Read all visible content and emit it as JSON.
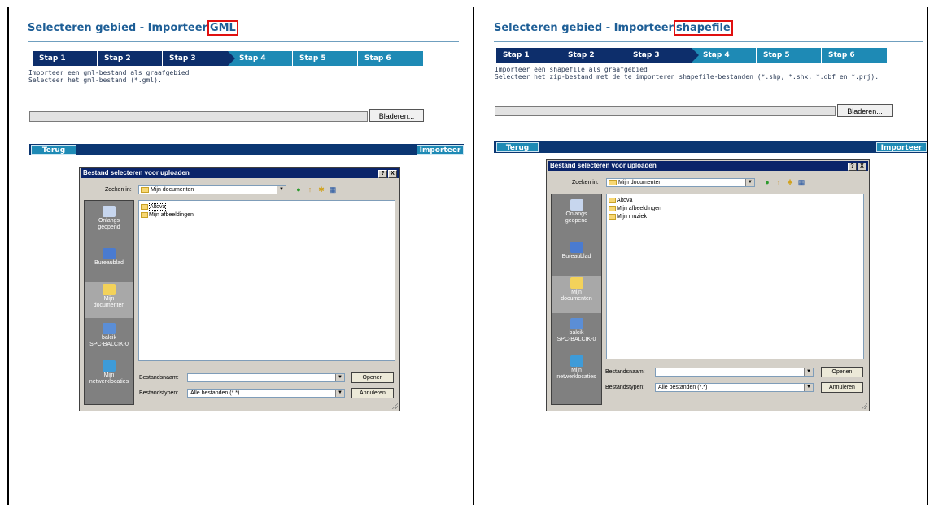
{
  "panels": [
    {
      "title_prefix": "Selecteren gebied - Importeer",
      "title_highlight": "GML",
      "steps": [
        {
          "label": "Stap 1",
          "state": "done"
        },
        {
          "label": "Stap 2",
          "state": "done"
        },
        {
          "label": "Stap 3",
          "state": "current"
        },
        {
          "label": "Stap 4",
          "state": "todo"
        },
        {
          "label": "Stap 5",
          "state": "todo"
        },
        {
          "label": "Stap 6",
          "state": "todo"
        }
      ],
      "instruction_line1": "Importeer een gml-bestand als graafgebied",
      "instruction_line2": "Selecteer het gml-bestand (*.gml).",
      "browse_label": "Bladeren...",
      "back_label": "Terug",
      "import_label": "Importeer",
      "dialog": {
        "title": "Bestand selecteren voor uploaden",
        "help_btn": "?",
        "close_btn": "X",
        "look_in_label": "Zoeken in:",
        "look_in_value": "Mijn documenten",
        "places": [
          "Onlangs\ngeopend",
          "Bureaublad",
          "Mijn\ndocumenten",
          "balcik\nSPC-BALCIK-0",
          "Mijn\nnetwerklocaties"
        ],
        "selected_place": 2,
        "files": [
          "Altova",
          "Mijn afbeeldingen"
        ],
        "filename_label": "Bestandsnaam:",
        "filename_value": "",
        "filetype_label": "Bestandstypen:",
        "filetype_value": "Alle bestanden (*.*)",
        "open_label": "Openen",
        "cancel_label": "Annuleren"
      }
    },
    {
      "title_prefix": "Selecteren gebied - Importeer",
      "title_highlight": "shapefile",
      "steps": [
        {
          "label": "Stap 1",
          "state": "done"
        },
        {
          "label": "Stap 2",
          "state": "done"
        },
        {
          "label": "Stap 3",
          "state": "current"
        },
        {
          "label": "Stap 4",
          "state": "todo"
        },
        {
          "label": "Stap 5",
          "state": "todo"
        },
        {
          "label": "Stap 6",
          "state": "todo"
        }
      ],
      "instruction_line1": "Importeer een shapefile als graafgebied",
      "instruction_line2": "Selecteer het zip-bestand met de te importeren shapefile-bestanden (*.shp, *.shx, *.dbf en *.prj).",
      "browse_label": "Bladeren...",
      "back_label": "Terug",
      "import_label": "Importeer",
      "dialog": {
        "title": "Bestand selecteren voor uploaden",
        "help_btn": "?",
        "close_btn": "X",
        "look_in_label": "Zoeken in:",
        "look_in_value": "Mijn documenten",
        "places": [
          "Onlangs\ngeopend",
          "Bureaublad",
          "Mijn\ndocumenten",
          "balcik\nSPC-BALCIK-0",
          "Mijn\nnetwerklocaties"
        ],
        "selected_place": 2,
        "files": [
          "Altova",
          "Mijn afbeeldingen",
          "Mijn muziek"
        ],
        "filename_label": "Bestandsnaam:",
        "filename_value": "",
        "filetype_label": "Bestandstypen:",
        "filetype_value": "Alle bestanden (*.*)",
        "open_label": "Openen",
        "cancel_label": "Annuleren"
      }
    }
  ],
  "colors": {
    "title": "#1d5e96",
    "step_done": "#0d2e6b",
    "step_todo": "#1e8ab5",
    "navbar": "#0b3672",
    "highlight_box": "#e01010",
    "dialog_titlebar": "#0a246a"
  },
  "icons": {
    "places": [
      "recent-documents-icon",
      "desktop-icon",
      "my-documents-icon",
      "my-computer-icon",
      "network-places-icon"
    ],
    "toolbar": [
      "back-icon",
      "up-folder-icon",
      "new-folder-icon",
      "view-menu-icon"
    ]
  }
}
